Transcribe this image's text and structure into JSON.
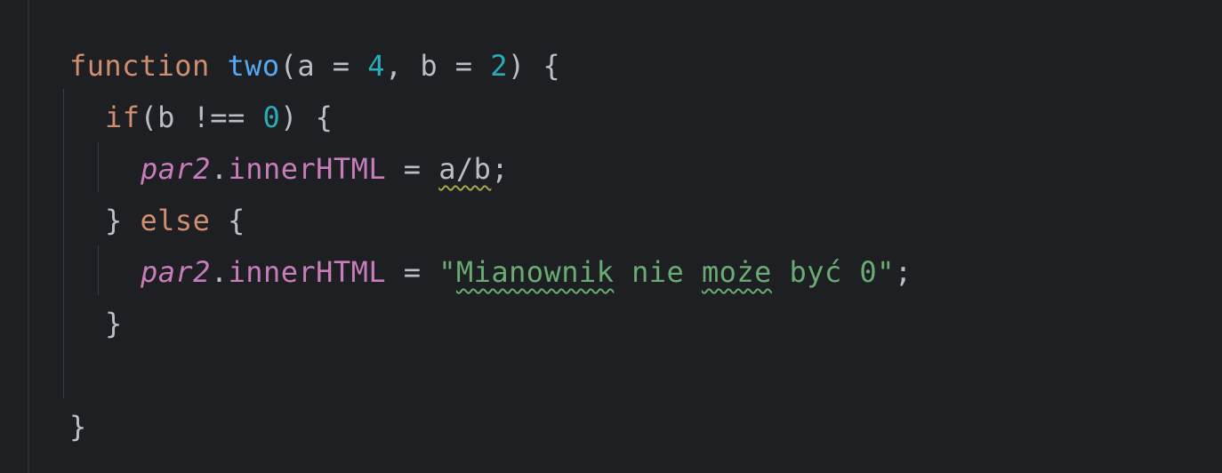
{
  "editor": {
    "language": "javascript",
    "colors": {
      "background": "#1e1f22",
      "keyword": "#cf8e6d",
      "function_name": "#56a8f5",
      "number": "#2aacb8",
      "property": "#c77dbb",
      "string": "#6aab73",
      "default_text": "#bcbec4"
    },
    "lines": {
      "l1": {
        "kw_function": "function",
        "fn_name": "two",
        "params_open": "(a = ",
        "num_a": "4",
        "params_mid": ", b = ",
        "num_b": "2",
        "params_close": ") {"
      },
      "l2": {
        "kw_if": "if",
        "cond_open": "(b !== ",
        "num_zero": "0",
        "cond_close": ") {"
      },
      "l3": {
        "var": "par2",
        "dot": ".",
        "prop": "innerHTML",
        "assign": " = ",
        "expr": "a/b",
        "semi": ";"
      },
      "l4": {
        "close_brace": "} ",
        "kw_else": "else",
        "open_brace": " {"
      },
      "l5": {
        "var": "par2",
        "dot": ".",
        "prop": "innerHTML",
        "assign": " = ",
        "str_quote_open": "\"",
        "str_word1": "Mianownik",
        "str_space1": " nie ",
        "str_word2": "może",
        "str_rest": " być 0",
        "str_quote_close": "\"",
        "semi": ";"
      },
      "l6": {
        "close_brace": "}"
      },
      "l8": {
        "close_brace": "}"
      }
    }
  }
}
